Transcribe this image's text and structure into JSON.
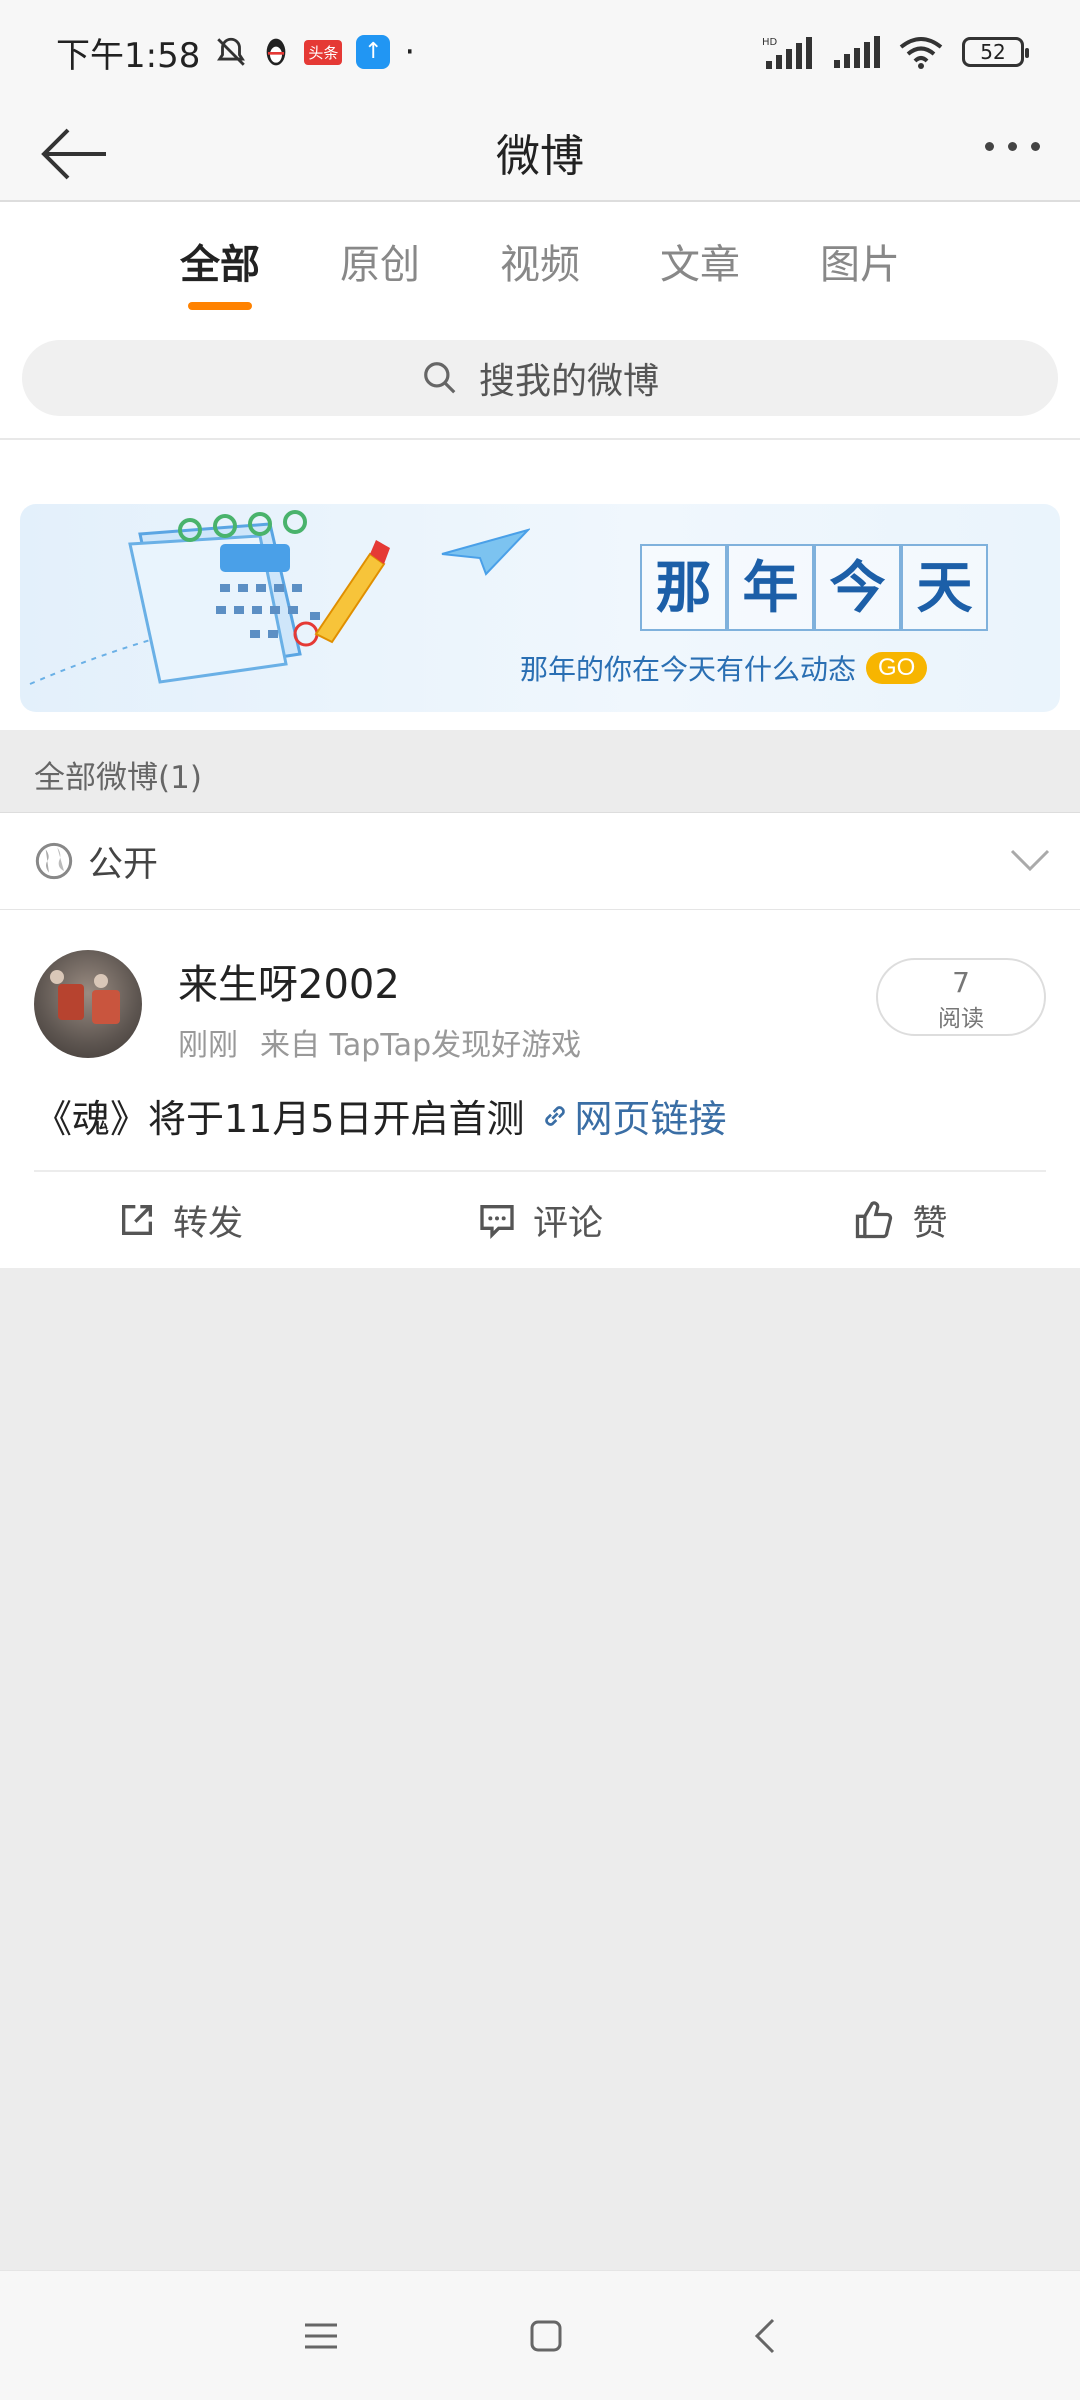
{
  "status_bar": {
    "time": "下午1:58",
    "badge_text": "头条",
    "dot": "·",
    "battery": "52"
  },
  "header": {
    "title": "微博"
  },
  "tabs": [
    {
      "label": "全部",
      "active": true
    },
    {
      "label": "原创",
      "active": false
    },
    {
      "label": "视频",
      "active": false
    },
    {
      "label": "文章",
      "active": false
    },
    {
      "label": "图片",
      "active": false
    }
  ],
  "search": {
    "placeholder": "搜我的微博"
  },
  "banner": {
    "title_chars": [
      "那",
      "年",
      "今",
      "天"
    ],
    "subtitle": "那年的你在今天有什么动态",
    "go_label": "GO"
  },
  "section": {
    "label": "全部微博(1)"
  },
  "filter": {
    "label": "公开"
  },
  "post": {
    "username": "来生呀2002",
    "time": "刚刚",
    "source": "来自 TapTap发现好游戏",
    "read_count": "7",
    "read_label": "阅读",
    "text": "《魂》将于11月5日开启首测",
    "link_label": "网页链接",
    "actions": {
      "repost": "转发",
      "comment": "评论",
      "like": "赞"
    }
  },
  "colors": {
    "accent": "#ff8200",
    "link": "#3a6ea5",
    "banner_text": "#1c5fa8",
    "go_badge": "#f7b500"
  }
}
